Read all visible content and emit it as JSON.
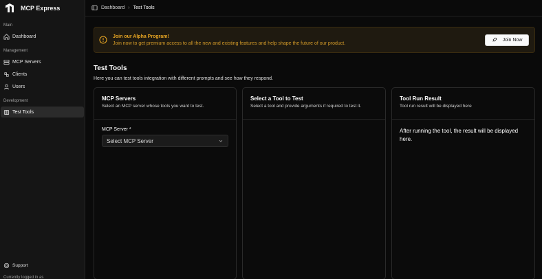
{
  "app": {
    "name": "MCP Express"
  },
  "sidebar": {
    "sections": [
      {
        "title": "Main",
        "items": [
          {
            "label": "Dashboard",
            "icon": "home-icon"
          }
        ]
      },
      {
        "title": "Management",
        "items": [
          {
            "label": "MCP Servers",
            "icon": "server-icon"
          },
          {
            "label": "Clients",
            "icon": "clients-icon"
          },
          {
            "label": "Users",
            "icon": "user-icon"
          }
        ]
      },
      {
        "title": "Development",
        "items": [
          {
            "label": "Test Tools",
            "icon": "tools-icon",
            "active": true
          }
        ]
      }
    ],
    "support_label": "Support",
    "logged_in_text": "Currently logged in as"
  },
  "breadcrumb": {
    "items": [
      "Dashboard",
      "Test Tools"
    ],
    "separator": "›"
  },
  "banner": {
    "title": "Join our Alpha Program!",
    "description": "Join now to get premium access to all the new and existing features and help shape the future of our product.",
    "button_label": "Join Now"
  },
  "page": {
    "title": "Test Tools",
    "description": "Here you can test tools integration with different prompts and see how they respond."
  },
  "cards": {
    "servers": {
      "title": "MCP Servers",
      "description": "Select an MCP server whose tools you want to test.",
      "field_label": "MCP Server *",
      "select_value": "Select MCP Server"
    },
    "tool": {
      "title": "Select a Tool to Test",
      "description": "Select a tool and provide arguments if required to test it."
    },
    "result": {
      "title": "Tool Run Result",
      "description": "Tool run result will be displayed here",
      "body": "After running the tool, the result will be displayed here."
    }
  },
  "colors": {
    "accent_warning": "#e8a623",
    "background": "#0a0a0a",
    "sidebar": "#151515"
  }
}
